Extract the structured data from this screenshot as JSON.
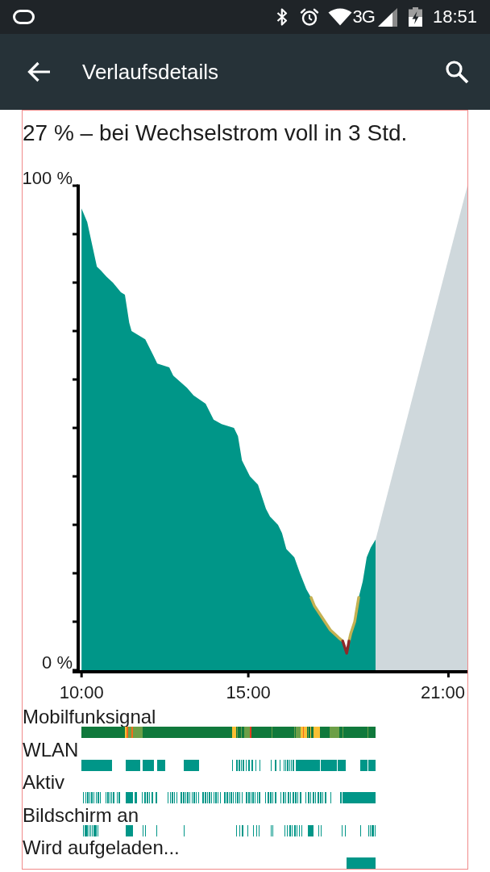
{
  "status_bar": {
    "network": "3G",
    "time": "18:51"
  },
  "app_bar": {
    "title": "Verlaufsdetails"
  },
  "summary": "27 % – bei Wechselstrom voll in 3 Std.",
  "chart": {
    "chart_data": {
      "type": "area",
      "x": [
        10.0,
        10.17,
        10.46,
        10.58,
        10.75,
        10.94,
        11.18,
        11.3,
        11.43,
        11.5,
        11.91,
        12.15,
        12.27,
        12.63,
        12.75,
        13.16,
        13.36,
        13.72,
        13.96,
        14.2,
        14.57,
        14.69,
        14.81,
        15.05,
        15.29,
        15.53,
        15.65,
        15.89,
        16.01,
        16.14,
        16.38,
        16.55,
        16.74,
        16.88,
        16.98,
        17.22,
        17.46,
        17.71,
        17.83,
        17.95,
        18.02,
        18.07,
        18.19,
        18.31,
        18.43,
        18.55,
        18.67,
        18.82,
        21.57
      ],
      "series": [
        {
          "color": "#009688",
          "values": [
            95.3,
            92.5,
            83.3,
            82.5,
            81.2,
            80.0,
            78.0,
            77.5,
            71.7,
            70.0,
            68.3,
            65.0,
            63.3,
            62.5,
            60.8,
            58.3,
            56.7,
            55.0,
            51.7,
            50.8,
            50.0,
            48.3,
            43.3,
            40.0,
            38.3,
            33.3,
            31.7,
            30.0,
            28.3,
            25.0,
            23.3,
            20.0,
            16.7,
            15.0,
            13.3,
            10.8,
            8.3,
            6.7,
            6.0,
            3.5,
            6.0,
            7.5,
            10.0,
            15.0,
            18.3,
            23.3,
            25.3,
            27.0,
            null
          ]
        },
        {
          "color": "#cfd8dc",
          "values": [
            null,
            null,
            null,
            null,
            null,
            null,
            null,
            null,
            null,
            null,
            null,
            null,
            null,
            null,
            null,
            null,
            null,
            null,
            null,
            null,
            null,
            null,
            null,
            null,
            null,
            null,
            null,
            null,
            null,
            null,
            null,
            null,
            null,
            null,
            null,
            null,
            null,
            null,
            null,
            null,
            null,
            null,
            null,
            null,
            null,
            null,
            null,
            27.0,
            100.0
          ]
        },
        {
          "type": "line",
          "color": "#c4b152",
          "values": [
            null,
            null,
            null,
            null,
            null,
            null,
            null,
            null,
            null,
            null,
            null,
            null,
            null,
            null,
            null,
            null,
            null,
            null,
            null,
            null,
            null,
            null,
            null,
            null,
            null,
            null,
            null,
            null,
            null,
            null,
            null,
            null,
            null,
            15.0,
            13.3,
            10.8,
            8.3,
            6.7,
            6.0,
            null,
            6.0,
            7.5,
            10.0,
            15.0,
            null,
            null,
            null,
            null,
            null
          ]
        },
        {
          "type": "line",
          "color": "#8e2a2a",
          "values": [
            null,
            null,
            null,
            null,
            null,
            null,
            null,
            null,
            null,
            null,
            null,
            null,
            null,
            null,
            null,
            null,
            null,
            null,
            null,
            null,
            null,
            null,
            null,
            null,
            null,
            null,
            null,
            null,
            null,
            null,
            null,
            null,
            null,
            null,
            null,
            null,
            null,
            null,
            6.0,
            3.5,
            6.0,
            null,
            null,
            null,
            null,
            null,
            null,
            null,
            null
          ]
        }
      ],
      "xlim": [
        9.73,
        21.57
      ],
      "ylim": [
        0,
        100
      ],
      "xticks": [
        {
          "value": 10,
          "label": "10:00"
        },
        {
          "value": 15,
          "label": "15:00"
        },
        {
          "value": 21,
          "label": "21:00"
        }
      ],
      "yticks": [
        {
          "value": 0,
          "label": "0 %"
        },
        {
          "value": 100,
          "label": "100 %"
        }
      ]
    }
  },
  "tracks": [
    {
      "label": "Mobilfunksignal",
      "kind": "signal"
    },
    {
      "label": "WLAN",
      "kind": "timeline"
    },
    {
      "label": "Aktiv",
      "kind": "timeline"
    },
    {
      "label": "Bildschirm an",
      "kind": "timeline"
    },
    {
      "label": "Wird aufgeladen...",
      "kind": "timeline"
    }
  ]
}
